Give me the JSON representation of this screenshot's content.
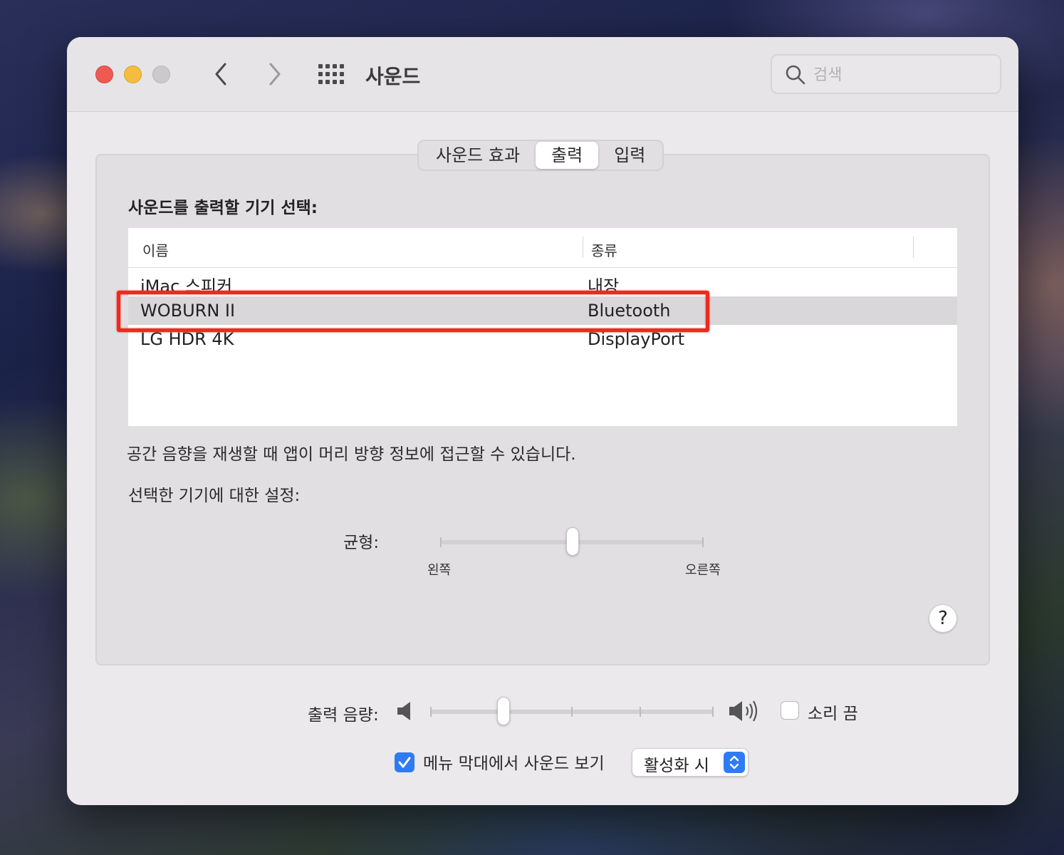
{
  "window": {
    "title": "사운드",
    "search_placeholder": "검색"
  },
  "tabs": [
    {
      "label": "사운드 효과",
      "active": false
    },
    {
      "label": "출력",
      "active": true
    },
    {
      "label": "입력",
      "active": false
    }
  ],
  "output": {
    "heading": "사운드를 출력할 기기 선택:",
    "columns": {
      "name": "이름",
      "kind": "종류"
    },
    "devices": [
      {
        "name": "iMac 스피커",
        "kind": "내장",
        "selected": false
      },
      {
        "name": "WOBURN II",
        "kind": "Bluetooth",
        "selected": true
      },
      {
        "name": "LG HDR 4K",
        "kind": "DisplayPort",
        "selected": false
      }
    ],
    "info_text": "공간 음향을 재생할 때 앱이 머리 방향 정보에 접근할 수 있습니다.",
    "settings_label": "선택한 기기에 대한 설정:",
    "balance": {
      "label": "균형:",
      "left_label": "왼쪽",
      "right_label": "오른쪽",
      "value": 0.5
    }
  },
  "help": {
    "label": "?"
  },
  "volume": {
    "label": "출력 음량:",
    "value": 0.26,
    "mute_label": "소리 끔",
    "muted": false
  },
  "menubar": {
    "label": "메뉴 막대에서 사운드 보기",
    "checked": true,
    "select_value": "활성화 시"
  },
  "colors": {
    "accent": "#2f7bf6",
    "annotation": "#ee2a1e",
    "close": "#ee5a52",
    "minimize": "#f5bd3f",
    "zoom_disabled": "#cbc9cc"
  },
  "icons": {
    "back": "chevron-left-icon",
    "forward": "chevron-right-icon",
    "grid": "grid-icon",
    "search": "search-icon",
    "speaker_low": "speaker-low-icon",
    "speaker_high": "speaker-high-icon",
    "checkmark": "checkmark-icon",
    "stepper": "up-down-chevron-icon"
  }
}
